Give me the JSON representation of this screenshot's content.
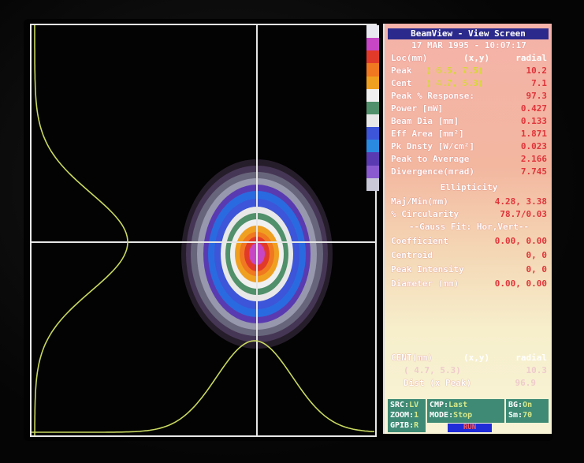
{
  "panel": {
    "title": "BeamView - View Screen",
    "datetime": "17 MAR 1995 - 10:07:17",
    "location": {
      "label": "Loc(mm)",
      "cols": "(x,y)",
      "radial": "radial"
    },
    "peak": {
      "label": "Peak",
      "value": "( 6.5, 7.5)",
      "radial": "10.2"
    },
    "cent": {
      "label": "Cent",
      "value": "( 4.7, 5.3)",
      "radial": "7.1"
    },
    "peak_response": {
      "label": "Peak % Response:",
      "value": "97.3"
    },
    "power": {
      "label": "Power [mW]",
      "value": "0.427"
    },
    "beam_dia": {
      "label": "Beam Dia [mm]",
      "value": "0.133"
    },
    "eff_area": {
      "label": "Eff Area [mm²]",
      "value": "1.871"
    },
    "pk_dnsty": {
      "label": "Pk Dnsty [W/cm²]",
      "value": "0.023"
    },
    "peak_to_avg": {
      "label": "Peak to Average",
      "value": "2.166"
    },
    "divergence": {
      "label": "Divergence(mrad)",
      "value": "7.745"
    },
    "ellipticity_header": "Ellipticity",
    "maj_min": {
      "label": "Maj/Min(mm)",
      "value": "4.28, 3.38"
    },
    "circularity": {
      "label": "% Circularity",
      "value": "78.7/0.03"
    },
    "gauss_header": "--Gauss Fit: Hor,Vert--",
    "coefficient": {
      "label": "Coefficient",
      "value": "0.00, 0.00"
    },
    "centroid": {
      "label": "Centroid",
      "value": "0,  0"
    },
    "peak_intensity": {
      "label": "Peak Intensity",
      "value": "0,  0"
    },
    "diameter": {
      "label": "Diameter (mm)",
      "value": "0.00, 0.00"
    },
    "cent_rows": {
      "label": "CENT(mm)",
      "cols": "(x,y)",
      "radial": "radial"
    },
    "cent_value": {
      "value": "( 4.7, 5.3)",
      "radial": "10.3"
    },
    "dist": {
      "label": "Dist (x Peak)",
      "value": "96.9"
    }
  },
  "status": {
    "src": {
      "label": "SRC:",
      "value": "LV"
    },
    "zoom": {
      "label": "ZOOM:",
      "value": "1"
    },
    "gpib": {
      "label": "GPIB:",
      "value": "R"
    },
    "cmp": {
      "label": "CMP:",
      "value": "Last"
    },
    "mode": {
      "label": "MODE:",
      "value": "Stop"
    },
    "bg": {
      "label": "BG:",
      "value": "On"
    },
    "sm": {
      "label": "Sm:",
      "value": "70"
    },
    "run": "RUN"
  },
  "colors": {
    "crosshair": "#e6e6e6",
    "profile": "#c8d860",
    "palette": [
      "#e8e8f0",
      "#c646c6",
      "#e23a2a",
      "#f07820",
      "#f0a020",
      "#f0f0f0",
      "#50906a",
      "#e8e8e8",
      "#3d55d8",
      "#2a8ae0",
      "#5a3ab0",
      "#8a5ad0",
      "#c8c8d8"
    ]
  }
}
